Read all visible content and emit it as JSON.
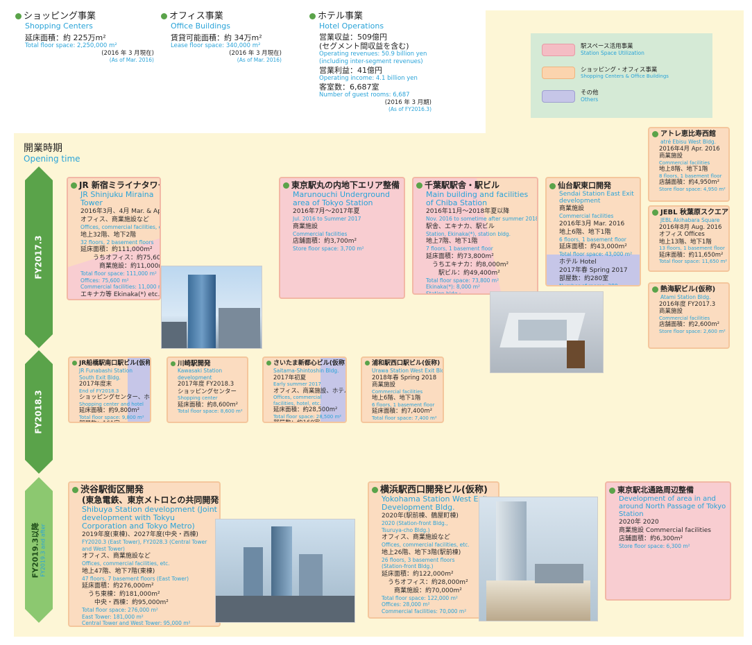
{
  "top": {
    "shopping": {
      "title": "ショッピング事業",
      "title_en": "Shopping Centers",
      "l1": "延床面積：約 225万m²",
      "l1_en": "Total floor space: 2,250,000 m²",
      "asof": "(2016 年 3 月現在)",
      "asof_en": "(As of Mar. 2016)"
    },
    "office": {
      "title": "オフィス事業",
      "title_en": "Office Buildings",
      "l1": "賃貸可能面積：約 34万m²",
      "l1_en": "Lease floor space: 340,000 m²",
      "asof": "(2016 年 3 月現在)",
      "asof_en": "(As of Mar. 2016)"
    },
    "hotel": {
      "title": "ホテル事業",
      "title_en": "Hotel Operations",
      "l1": "営業収益：509億円",
      "l2": "(セグメント間収益を含む)",
      "l1_en": "Operating revenues: 50.9 billion yen",
      "l2_en": "(including inter-segment revenues)",
      "l3": "営業利益：41億円",
      "l3_en": "Operating income: 4.1 billion yen",
      "l4": "客室数：6,687室",
      "l4_en": "Number of guest rooms: 6,687",
      "asof": "(2016 年 3 月期)",
      "asof_en": "(As of FY2016.3)"
    }
  },
  "legend": [
    {
      "ja": "駅スペース活用事業",
      "en": "Station Space Utilization",
      "color": "#f4bdc4"
    },
    {
      "ja": "ショッピング・オフィス事業",
      "en": "Shopping Centers & Office Buildings",
      "color": "#fbd4ae"
    },
    {
      "ja": "その他",
      "en": "Others",
      "color": "#c6c6e8"
    }
  ],
  "opening": {
    "ja": "開業時期",
    "en": "Opening time"
  },
  "periods": [
    {
      "label": "FY2017.3"
    },
    {
      "label": "FY2018.3"
    },
    {
      "label": "FY2019.3以降",
      "label_en": "FY2019.3 and after"
    }
  ],
  "colors": {
    "pink": "#f8cdd1",
    "orange": "#fbdcc0",
    "purple": "#c6c6e8",
    "green": "#5aa34a",
    "cyan": "#29a3d8",
    "band": "#fdf6d6"
  },
  "p1": {
    "title": "JR 新宿ミライナタワー",
    "title_en": "JR Shinjuku Miraina Tower",
    "lines": [
      [
        "c",
        "2016年3月、4月  Mar. & Apr. 2016"
      ],
      [
        "c",
        "オフィス、商業施設など"
      ],
      [
        "en",
        "Offices, commercial facilities, etc."
      ],
      [
        "c",
        "地上32階、地下2階"
      ],
      [
        "en",
        "32 floors, 2 basement floors"
      ],
      [
        "c",
        "延床面積：約111,000m²"
      ],
      [
        "c",
        "　　うちオフィス：約75,600m²"
      ],
      [
        "c",
        "　　　商業施設：約11,000m²"
      ],
      [
        "en",
        "Total floor space: 111,000 m²"
      ],
      [
        "en",
        "   Offices: 75,600 m²"
      ],
      [
        "en",
        "   Commercial facilities: 11,000 m²"
      ],
      [
        "c",
        "エキナカ等  Ekinaka(*) etc."
      ],
      [
        "c",
        "店舗面積：約2,000m²"
      ],
      [
        "en",
        "Store floor space: 2,000 m²"
      ],
      [
        "en",
        "(*) Commercial space inside the"
      ],
      [
        "en",
        "station"
      ]
    ]
  },
  "p2": {
    "title": "東京駅丸の内地下エリア整備",
    "title_en": "Marunouchi Underground area of Tokyo Station",
    "lines": [
      [
        "c",
        "2016年7月～2017年夏"
      ],
      [
        "en",
        "Jul. 2016 to Summer 2017"
      ],
      [
        "c",
        "商業施設"
      ],
      [
        "en",
        "Commercial facilities"
      ],
      [
        "c",
        "店舗面積：約3,700m²"
      ],
      [
        "en",
        "Store floor space: 3,700 m²"
      ]
    ]
  },
  "p3": {
    "title": "千葉駅駅舎・駅ビル",
    "title_en": "Main building and facilities of Chiba Station",
    "lines": [
      [
        "c",
        "2016年11月～2018年夏以降"
      ],
      [
        "en",
        "Nov. 2016 to sometime after summer 2018"
      ],
      [
        "c",
        "駅舎、エキナカ、駅ビル"
      ],
      [
        "en",
        "Station, Ekinaka(*), station bldg."
      ],
      [
        "c",
        "地上7階、地下1階"
      ],
      [
        "en",
        "7 floors, 1 basement floor"
      ],
      [
        "c",
        "延床面積：約73,800m²"
      ],
      [
        "c",
        "　うちエキナカ：約8,000m²"
      ],
      [
        "c",
        "　　駅ビル：約49,400m²"
      ],
      [
        "en",
        "Total floor space: 73,800 m²"
      ],
      [
        "en",
        "   Ekinaka(*): 8,000 m²"
      ],
      [
        "en",
        "   Station bldg.:"
      ],
      [
        "en",
        "              49,400 m²"
      ],
      [
        "en",
        "(*) Commercial space"
      ],
      [
        "en",
        "inside the station"
      ]
    ]
  },
  "p4": {
    "title": "仙台駅東口開発",
    "title_en": "Sendai Station East Exit development",
    "lines": [
      [
        "c",
        "商業施設"
      ],
      [
        "en",
        "Commercial facilities"
      ],
      [
        "c",
        "2016年3月  Mar. 2016"
      ],
      [
        "c",
        "地上6階、地下1階"
      ],
      [
        "en",
        "6 floors, 1 basement floor"
      ],
      [
        "c",
        "延床面積：約43,000m²"
      ],
      [
        "en",
        "Total floor space: 43,000 m²"
      ],
      [
        "c",
        "ホテル  Hotel"
      ],
      [
        "c",
        "2017年春  Spring 2017"
      ],
      [
        "c",
        "部屋数：約280室"
      ],
      [
        "en",
        "Number of rooms: 280"
      ]
    ]
  },
  "r1": {
    "title": "アトレ恵比寿西館",
    "title_en": "atré Ebisu West Bldg.",
    "lines": [
      [
        "c",
        "2016年4月  Apr. 2016"
      ],
      [
        "c",
        "商業施設"
      ],
      [
        "en",
        "Commercial facilities"
      ],
      [
        "c",
        "地上8階、地下1階"
      ],
      [
        "en",
        "8 floors, 1 basement floor"
      ],
      [
        "c",
        "店舗面積：約4,950m²"
      ],
      [
        "en",
        "Store floor space: 4,950 m²"
      ]
    ]
  },
  "r2": {
    "title": "JEBL 秋葉原スクエア",
    "title_en": "JEBL Akihabara Square",
    "lines": [
      [
        "c",
        "2016年8月  Aug. 2016"
      ],
      [
        "c",
        "オフィス  Offices"
      ],
      [
        "c",
        "地上13階、地下1階"
      ],
      [
        "en",
        "13 floors, 1 basement floor"
      ],
      [
        "c",
        "延床面積：約11,650m²"
      ],
      [
        "en",
        "Total floor space: 11,650 m²"
      ]
    ]
  },
  "r3": {
    "title": "熱海駅ビル(仮称)",
    "title_en": "Atami Station Bldg.",
    "lines": [
      [
        "c",
        "2016年度  FY2017.3"
      ],
      [
        "c",
        "商業施設"
      ],
      [
        "en",
        "Commercial facilities"
      ],
      [
        "c",
        "店舗面積：約2,600m²"
      ],
      [
        "en",
        "Store floor space: 2,600 m²"
      ]
    ]
  },
  "m1": {
    "title": "JR船橋駅南口駅ビル(仮称)",
    "title_en": "JR Funabashi Station South Exit Bldg.",
    "lines": [
      [
        "c",
        "2017年度末"
      ],
      [
        "en",
        "End of FY2018.3"
      ],
      [
        "c",
        "ショッピングセンター、ホテル"
      ],
      [
        "en",
        "Shopping center and hotel"
      ],
      [
        "c",
        "延床面積：約9,800m²"
      ],
      [
        "en",
        "Total floor space: 9,800 m²"
      ],
      [
        "c",
        "部屋数：161室"
      ],
      [
        "en",
        "Number of rooms: 161"
      ]
    ]
  },
  "m2": {
    "title": "川崎駅開発",
    "title_en": "Kawasaki Station development",
    "lines": [
      [
        "c",
        "2017年度  FY2018.3"
      ],
      [
        "c",
        "ショッピングセンター"
      ],
      [
        "en",
        "Shopping center"
      ],
      [
        "c",
        "延床面積：約8,600m²"
      ],
      [
        "en",
        "Total floor space: 8,600 m²"
      ]
    ]
  },
  "m3": {
    "title": "さいたま新都心ビル(仮称)",
    "title_en": "Saitama-Shintoshin Bldg.",
    "lines": [
      [
        "c",
        "2017年初夏"
      ],
      [
        "en",
        "Early summer 2017"
      ],
      [
        "c",
        "オフィス、商業施設、ホテルなど"
      ],
      [
        "en",
        "Offices, commercial"
      ],
      [
        "en",
        "facilities, hotel, etc."
      ],
      [
        "c",
        "延床面積：約28,500m²"
      ],
      [
        "en",
        "Total floor space: 28,500 m²"
      ],
      [
        "c",
        "部屋数：約160室"
      ],
      [
        "en",
        "Number of rooms: 160"
      ]
    ]
  },
  "m4": {
    "title": "浦和駅西口駅ビル(仮称)",
    "title_en": "Urawa Station West Exit Bldg.",
    "lines": [
      [
        "c",
        "2018年春  Spring 2018"
      ],
      [
        "c",
        "商業施設"
      ],
      [
        "en",
        "Commercial facilities"
      ],
      [
        "c",
        "地上6階、地下1階"
      ],
      [
        "en",
        "6 floors, 1 basement floor"
      ],
      [
        "c",
        "延床面積：約7,400m²"
      ],
      [
        "en",
        "Total floor space: 7,400 m²"
      ]
    ]
  },
  "b1": {
    "title": "渋谷駅街区開発",
    "title2": "(東急電鉄、東京メトロとの共同開発)",
    "title_en": "Shibuya Station development (Joint development with Tokyu Corporation and Tokyo Metro)",
    "lines": [
      [
        "c",
        "2019年度(東棟)、2027年度(中央・西棟)"
      ],
      [
        "en",
        "FY2020.3 (East Tower), FY2028.3 (Central Tower"
      ],
      [
        "en",
        "and West Tower)"
      ],
      [
        "c",
        "オフィス、商業施設など"
      ],
      [
        "en",
        "Offices, commercial facilities, etc."
      ],
      [
        "c",
        "地上47階、地下7階(東棟)"
      ],
      [
        "en",
        "47 floors, 7 basement floors (East Tower)"
      ],
      [
        "c",
        "延床面積：約276,000m²"
      ],
      [
        "c",
        "　うち東棟：約181,000m²"
      ],
      [
        "c",
        "　　中央・西棟：約95,000m²"
      ],
      [
        "en",
        "Total floor space: 276,000 m²"
      ],
      [
        "en",
        "   East Tower: 181,000 m²"
      ],
      [
        "en",
        "   Central Tower and West Tower: 95,000 m²"
      ]
    ]
  },
  "b2": {
    "title": "横浜駅西口開発ビル(仮称)",
    "title_en": "Yokohama Station West Exit Development Bldg.",
    "lines": [
      [
        "c",
        "2020年(駅前棟、鶴屋町棟)"
      ],
      [
        "en",
        "2020 (Station-front Bldg.,"
      ],
      [
        "en",
        "Tsuruya-cho Bldg.)"
      ],
      [
        "c",
        "オフィス、商業施設など"
      ],
      [
        "en",
        "Offices, commercial facilities, etc."
      ],
      [
        "c",
        "地上26階、地下3階(駅前棟)"
      ],
      [
        "en",
        "26 floors, 3 basement floors"
      ],
      [
        "en",
        "(Station-front Bldg.)"
      ],
      [
        "c",
        "延床面積：約122,000m²"
      ],
      [
        "c",
        "　うちオフィス：約28,000m²"
      ],
      [
        "c",
        "　　商業施設：約70,000m²"
      ],
      [
        "en",
        "Total floor space: 122,000 m²"
      ],
      [
        "en",
        "   Offices: 28,000 m²"
      ],
      [
        "en",
        "   Commercial facilities: 70,000 m²"
      ]
    ]
  },
  "b3": {
    "title": "東京駅北通路周辺整備",
    "title_en": "Development of area in and around North Passage of Tokyo Station",
    "lines": [
      [
        "c",
        "2020年  2020"
      ],
      [
        "c",
        "商業施設  Commercial facilities"
      ],
      [
        "c",
        "店舗面積：約6,300m²"
      ],
      [
        "en",
        "Store floor space: 6,300 m²"
      ]
    ]
  }
}
